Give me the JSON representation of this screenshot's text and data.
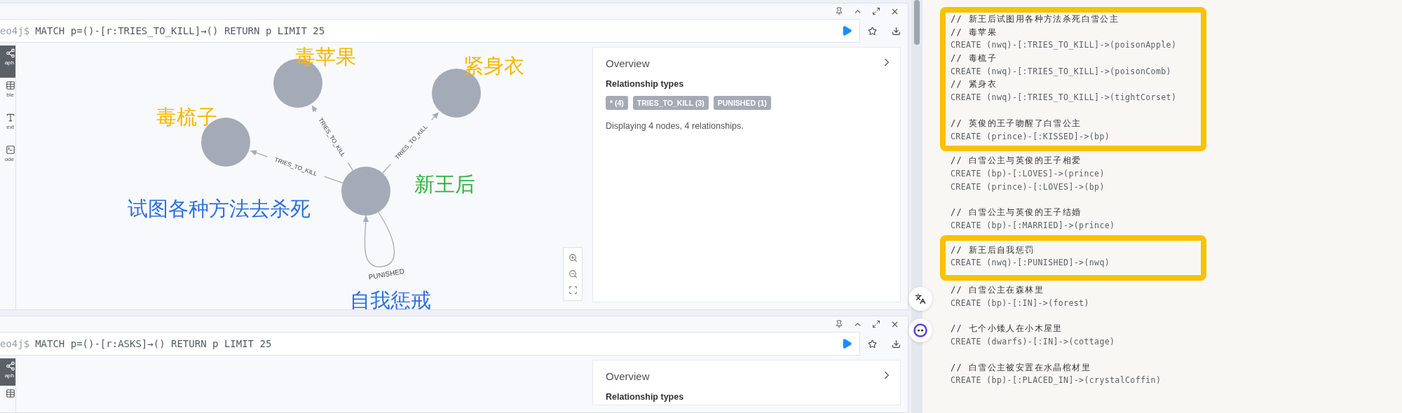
{
  "frames": [
    {
      "prompt": "eo4j$",
      "query": "MATCH p=()-[r:TRIES_TO_KILL]→() RETURN p LIMIT 25",
      "view_tabs": [
        {
          "kind": "graph",
          "label": "aph",
          "selected": true
        },
        {
          "kind": "table",
          "label": "ble",
          "selected": false
        },
        {
          "kind": "text",
          "label": "ext",
          "selected": false
        },
        {
          "kind": "code",
          "label": "ode",
          "selected": false
        }
      ],
      "graph": {
        "edges": [
          {
            "label": "TRIES_TO_KILL"
          },
          {
            "label": "TRIES_TO_KILL"
          },
          {
            "label": "TRIES_TO_KILL"
          },
          {
            "label": "PUNISHED"
          }
        ],
        "annotations": [
          {
            "text": "毒苹果",
            "color": "#f5b800"
          },
          {
            "text": "紧身衣",
            "color": "#f5b800"
          },
          {
            "text": "毒梳子",
            "color": "#f5b800"
          },
          {
            "text": "新王后",
            "color": "#2fb344"
          },
          {
            "text": "试图各种方法去杀死",
            "color": "#2f6fe0"
          },
          {
            "text": "自我惩戒",
            "color": "#2f6fe0"
          }
        ]
      },
      "overview": {
        "title": "Overview",
        "section": "Relationship types",
        "badges": [
          "* (4)",
          "TRIES_TO_KILL (3)",
          "PUNISHED (1)"
        ],
        "summary": "Displaying 4 nodes, 4 relationships."
      }
    },
    {
      "prompt": "eo4j$",
      "query": "MATCH p=()-[r:ASKS]→() RETURN p LIMIT 25",
      "view_tabs": [
        {
          "kind": "graph",
          "label": "aph",
          "selected": true
        },
        {
          "kind": "table",
          "selected": false
        }
      ],
      "overview": {
        "title": "Overview",
        "section": "Relationship types"
      }
    }
  ],
  "note": {
    "blocks": [
      {
        "highlighted": true,
        "paragraphs": [
          [
            {
              "kind": "comment",
              "text": "// 新王后试图用各种方法杀死白雪公主"
            },
            {
              "kind": "comment",
              "text": "// 毒苹果"
            },
            {
              "kind": "code",
              "text": "CREATE (nwq)-[:TRIES_TO_KILL]->(poisonApple)"
            },
            {
              "kind": "comment",
              "text": "// 毒梳子"
            },
            {
              "kind": "code",
              "text": "CREATE (nwq)-[:TRIES_TO_KILL]->(poisonComb)"
            },
            {
              "kind": "comment",
              "text": "// 紧身衣"
            },
            {
              "kind": "code",
              "text": "CREATE (nwq)-[:TRIES_TO_KILL]->(tightCorset)"
            }
          ],
          [
            {
              "kind": "comment",
              "text": "// 英俊的王子吻醒了白雪公主"
            },
            {
              "kind": "code",
              "text": "CREATE (prince)-[:KISSED]->(bp)"
            }
          ]
        ]
      },
      {
        "highlighted": false,
        "paragraphs": [
          [
            {
              "kind": "comment",
              "text": "// 白雪公主与英俊的王子相爱"
            },
            {
              "kind": "code",
              "text": "CREATE (bp)-[:LOVES]->(prince)"
            },
            {
              "kind": "code",
              "text": "CREATE (prince)-[:LOVES]->(bp)"
            }
          ],
          [
            {
              "kind": "comment",
              "text": "// 白雪公主与英俊的王子结婚"
            },
            {
              "kind": "code",
              "text": "CREATE (bp)-[:MARRIED]->(prince)"
            }
          ]
        ]
      },
      {
        "highlighted": true,
        "paragraphs": [
          [
            {
              "kind": "comment",
              "text": "// 新王后自我惩罚"
            },
            {
              "kind": "code",
              "text": "CREATE (nwq)-[:PUNISHED]->(nwq)"
            }
          ]
        ]
      },
      {
        "highlighted": false,
        "paragraphs": [
          [
            {
              "kind": "comment",
              "text": "// 白雪公主在森林里"
            },
            {
              "kind": "code",
              "text": "CREATE (bp)-[:IN]->(forest)"
            }
          ],
          [
            {
              "kind": "comment",
              "text": "// 七个小矮人在小木屋里"
            },
            {
              "kind": "code",
              "text": "CREATE (dwarfs)-[:IN]->(cottage)"
            }
          ],
          [
            {
              "kind": "comment",
              "text": "// 白雪公主被安置在水晶棺材里"
            },
            {
              "kind": "code",
              "text": "CREATE (bp)-[:PLACED_IN]->(crystalCoffin)"
            }
          ]
        ]
      }
    ]
  }
}
